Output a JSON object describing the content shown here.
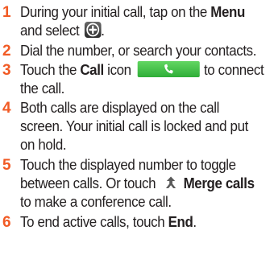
{
  "steps": [
    {
      "number": "1",
      "line1_text": "During your initial call, tap on the ",
      "line1_bold": "Menu",
      "line2_text": "and select ",
      "line2_end": ".",
      "icon": "add-call-icon"
    },
    {
      "number": "2",
      "line1_text": "Dial the number, or search your contacts."
    },
    {
      "number": "3",
      "line1_pre": "Touch the ",
      "line1_bold": "Call",
      "line1_mid": " icon",
      "line1_post": "to connect",
      "line2_text": "the call.",
      "icon": "phone-icon"
    },
    {
      "number": "4",
      "line1_text": "Both calls are displayed on the call",
      "line2_text": "screen. Your initial call is locked and put",
      "line3_text": "on hold."
    },
    {
      "number": "5",
      "line1_text": "Touch the displayed number to toggle",
      "line2_text": "between calls. Or touch ",
      "line2_bold": "Merge calls",
      "line3_text": "to make a conference call.",
      "icon": "merge-calls-icon"
    },
    {
      "number": "6",
      "line1_text": "To end active calls, touch ",
      "line1_bold": "End",
      "line1_end": "."
    }
  ],
  "colors": {
    "step_number": "#f15a24",
    "text": "#231f20",
    "call_button": "#3cc344"
  }
}
